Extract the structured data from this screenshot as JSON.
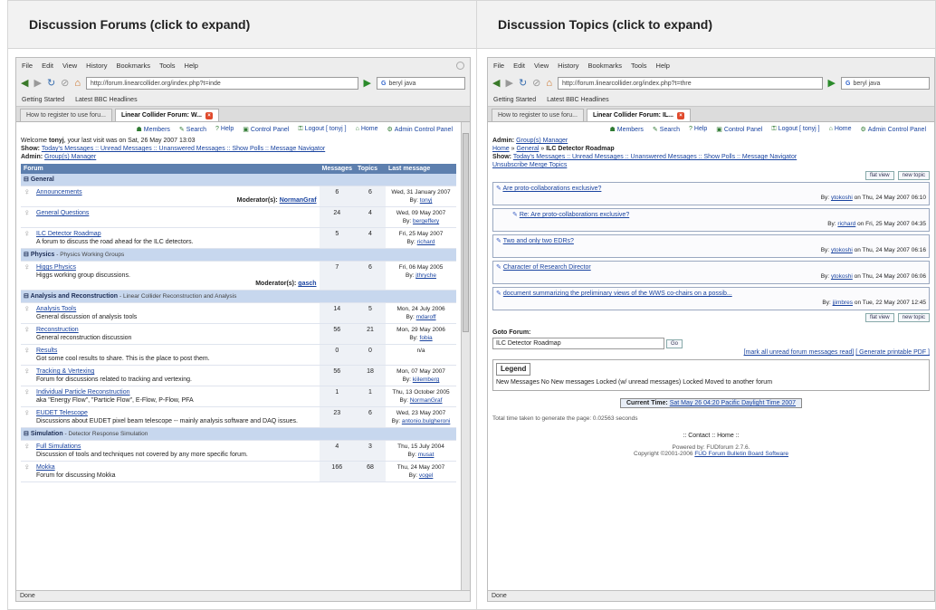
{
  "headers": {
    "left": "Discussion Forums (click to expand)",
    "right": "Discussion Topics (click to expand)"
  },
  "browser": {
    "menu": [
      "File",
      "Edit",
      "View",
      "History",
      "Bookmarks",
      "Tools",
      "Help"
    ],
    "bookmarks": [
      "Getting Started",
      "Latest BBC Headlines"
    ],
    "tab1": "How to register to use foru...",
    "tab2_left": "Linear Collider Forum: W...",
    "tab2_right": "Linear Collider Forum: IL...",
    "url_left": "http://forum.linearcollider.org/index.php?t=inde",
    "url_right": "http://forum.linearcollider.org/index.php?t=thre",
    "search": "beryl java",
    "status": "Done"
  },
  "left": {
    "toplinks": [
      "Members",
      "Search",
      "Help",
      "Control Panel",
      "Logout [ tonyj ]",
      "Home",
      "Admin Control Panel"
    ],
    "welcome_pre": "Welcome",
    "user": "tonyj",
    "welcome_post": ", your last visit was on Sat, 26 May 2007 13:03",
    "show_label": "Show:",
    "show_links": "Today's Messages :: Unread Messages :: Unanswered Messages :: Show Polls :: Message Navigator",
    "admin_label": "Admin:",
    "admin_link": "Group(s) Manager",
    "cols": [
      "Forum",
      "Messages",
      "Topics",
      "Last message"
    ],
    "categories": [
      {
        "name": "General",
        "sub": "",
        "forums": [
          {
            "title": "Announcements",
            "desc": "",
            "mods": "Moderator(s):",
            "modname": "NormanGraf",
            "msgs": "6",
            "topics": "6",
            "date": "Wed, 31 January 2007",
            "by": "tonyj"
          },
          {
            "title": "General Questions",
            "desc": "",
            "mods": "",
            "modname": "",
            "msgs": "24",
            "topics": "4",
            "date": "Wed, 09 May 2007",
            "by": "bergeffery"
          },
          {
            "title": "ILC Detector Roadmap",
            "desc": "A forum to discuss the road ahead for the ILC detectors.",
            "mods": "",
            "modname": "",
            "msgs": "5",
            "topics": "4",
            "date": "Fri, 25 May 2007",
            "by": "richard"
          }
        ]
      },
      {
        "name": "Physics",
        "sub": "- Physics Working Groups",
        "forums": [
          {
            "title": "Higgs Physics",
            "desc": "Higgs working group discussions.",
            "mods": "Moderator(s):",
            "modname": "gasch",
            "msgs": "7",
            "topics": "6",
            "date": "Fri, 06 May 2005",
            "by": "jthryche"
          }
        ]
      },
      {
        "name": "Analysis and Reconstruction",
        "sub": "- Linear Collider Reconstruction and Analysis",
        "forums": [
          {
            "title": "Analysis Tools",
            "desc": "General discussion of analysis tools",
            "mods": "",
            "modname": "",
            "msgs": "14",
            "topics": "5",
            "date": "Mon, 24 July 2006",
            "by": "mdaroff"
          },
          {
            "title": "Reconstruction",
            "desc": "General reconstruction discussion",
            "mods": "",
            "modname": "",
            "msgs": "56",
            "topics": "21",
            "date": "Mon, 29 May 2006",
            "by": "fobia"
          },
          {
            "title": "Results",
            "desc": "Got some cool results to share. This is the place to post them.",
            "mods": "",
            "modname": "",
            "msgs": "0",
            "topics": "0",
            "date": "n/a",
            "by": ""
          },
          {
            "title": "Tracking & Vertexing",
            "desc": "Forum for discussions related to tracking and vertexing.",
            "mods": "",
            "modname": "",
            "msgs": "56",
            "topics": "18",
            "date": "Mon, 07 May 2007",
            "by": "kiilemberg"
          },
          {
            "title": "Individual Particle Reconstruction",
            "desc": "aka \"Energy Flow\", \"Particle Flow\", E-Flow, P-Flow, PFA",
            "mods": "",
            "modname": "",
            "msgs": "1",
            "topics": "1",
            "date": "Thu, 13 October 2005",
            "by": "NormanGraf"
          },
          {
            "title": "EUDET Telescope",
            "desc": "Discussions about EUDET pixel beam telescope -- mainly analysis software and DAQ issues.",
            "mods": "",
            "modname": "",
            "msgs": "23",
            "topics": "6",
            "date": "Wed, 23 May 2007",
            "by": "antonio.bulgheroni"
          }
        ]
      },
      {
        "name": "Simulation",
        "sub": "- Detector Response Simulation",
        "forums": [
          {
            "title": "Full Simulations",
            "desc": "Discussion of tools and techniques not covered by any more specific forum.",
            "mods": "",
            "modname": "",
            "msgs": "4",
            "topics": "3",
            "date": "Thu, 15 July 2004",
            "by": "musat"
          },
          {
            "title": "Mokka",
            "desc": "Forum for discussing Mokka",
            "mods": "",
            "modname": "",
            "msgs": "166",
            "topics": "68",
            "date": "Thu, 24 May 2007",
            "by": "vogel"
          }
        ]
      }
    ]
  },
  "right": {
    "toplinks": [
      "Members",
      "Search",
      "Help",
      "Control Panel",
      "Logout [ tonyj ]",
      "Home",
      "Admin Control Panel"
    ],
    "admin_label": "Admin:",
    "admin_link": "Group(s) Manager",
    "crumb_home": "Home",
    "crumb_general": "General",
    "crumb_current": "ILC Detector Roadmap",
    "show_label": "Show:",
    "show_links": "Today's Messages :: Unread Messages :: Unanswered Messages :: Show Polls :: Message Navigator",
    "unsub": "Unsubscribe Merge Topics",
    "btn_flat": "flat view",
    "btn_new": "new topic",
    "posts": [
      {
        "title": "Are proto-collaborations exclusive?",
        "by": "ytokoshi",
        "date": "on Thu, 24 May 2007 06:10",
        "indent": false
      },
      {
        "title": "Re: Are proto-collaborations exclusive?",
        "by": "richard",
        "date": "on Fri, 25 May 2007 04:35",
        "indent": true
      },
      {
        "title": "Two and only two EDRs?",
        "by": "ytokoshi",
        "date": "on Thu, 24 May 2007 06:16",
        "indent": false
      },
      {
        "title": "Character of Research Director",
        "by": "ytokoshi",
        "date": "on Thu, 24 May 2007 06:06",
        "indent": false
      },
      {
        "title": "document summarizing the preliminary views of the WWS co-chairs on a possib...",
        "by": "jjimbres",
        "date": "on Tue, 22 May 2007 12:45",
        "indent": false
      }
    ],
    "by_label": "By:",
    "goto_label": "Goto Forum:",
    "goto_value": "ILC Detector Roadmap",
    "goto_btn": "Go",
    "mark_read": "[mark all unread forum messages read]",
    "printable": "[ Generate printable PDF ]",
    "legend_title": "Legend",
    "legend": "New Messages    No New messages    Locked (w/ unread messages)    Locked    Moved to another forum",
    "current_time_label": "Current Time:",
    "current_time": "Sat May 26 04:20 Pacific Daylight Time 2007",
    "time_taken": "Total time taken to generate the page: 0.02563 seconds",
    "footer_links": ":: Contact :: Home ::",
    "powered": "Powered by: FUDforum 2.7.6.",
    "copyright": "Copyright ©2001-2006",
    "copyright_link": "FUD Forum Bulletin Board Software"
  }
}
